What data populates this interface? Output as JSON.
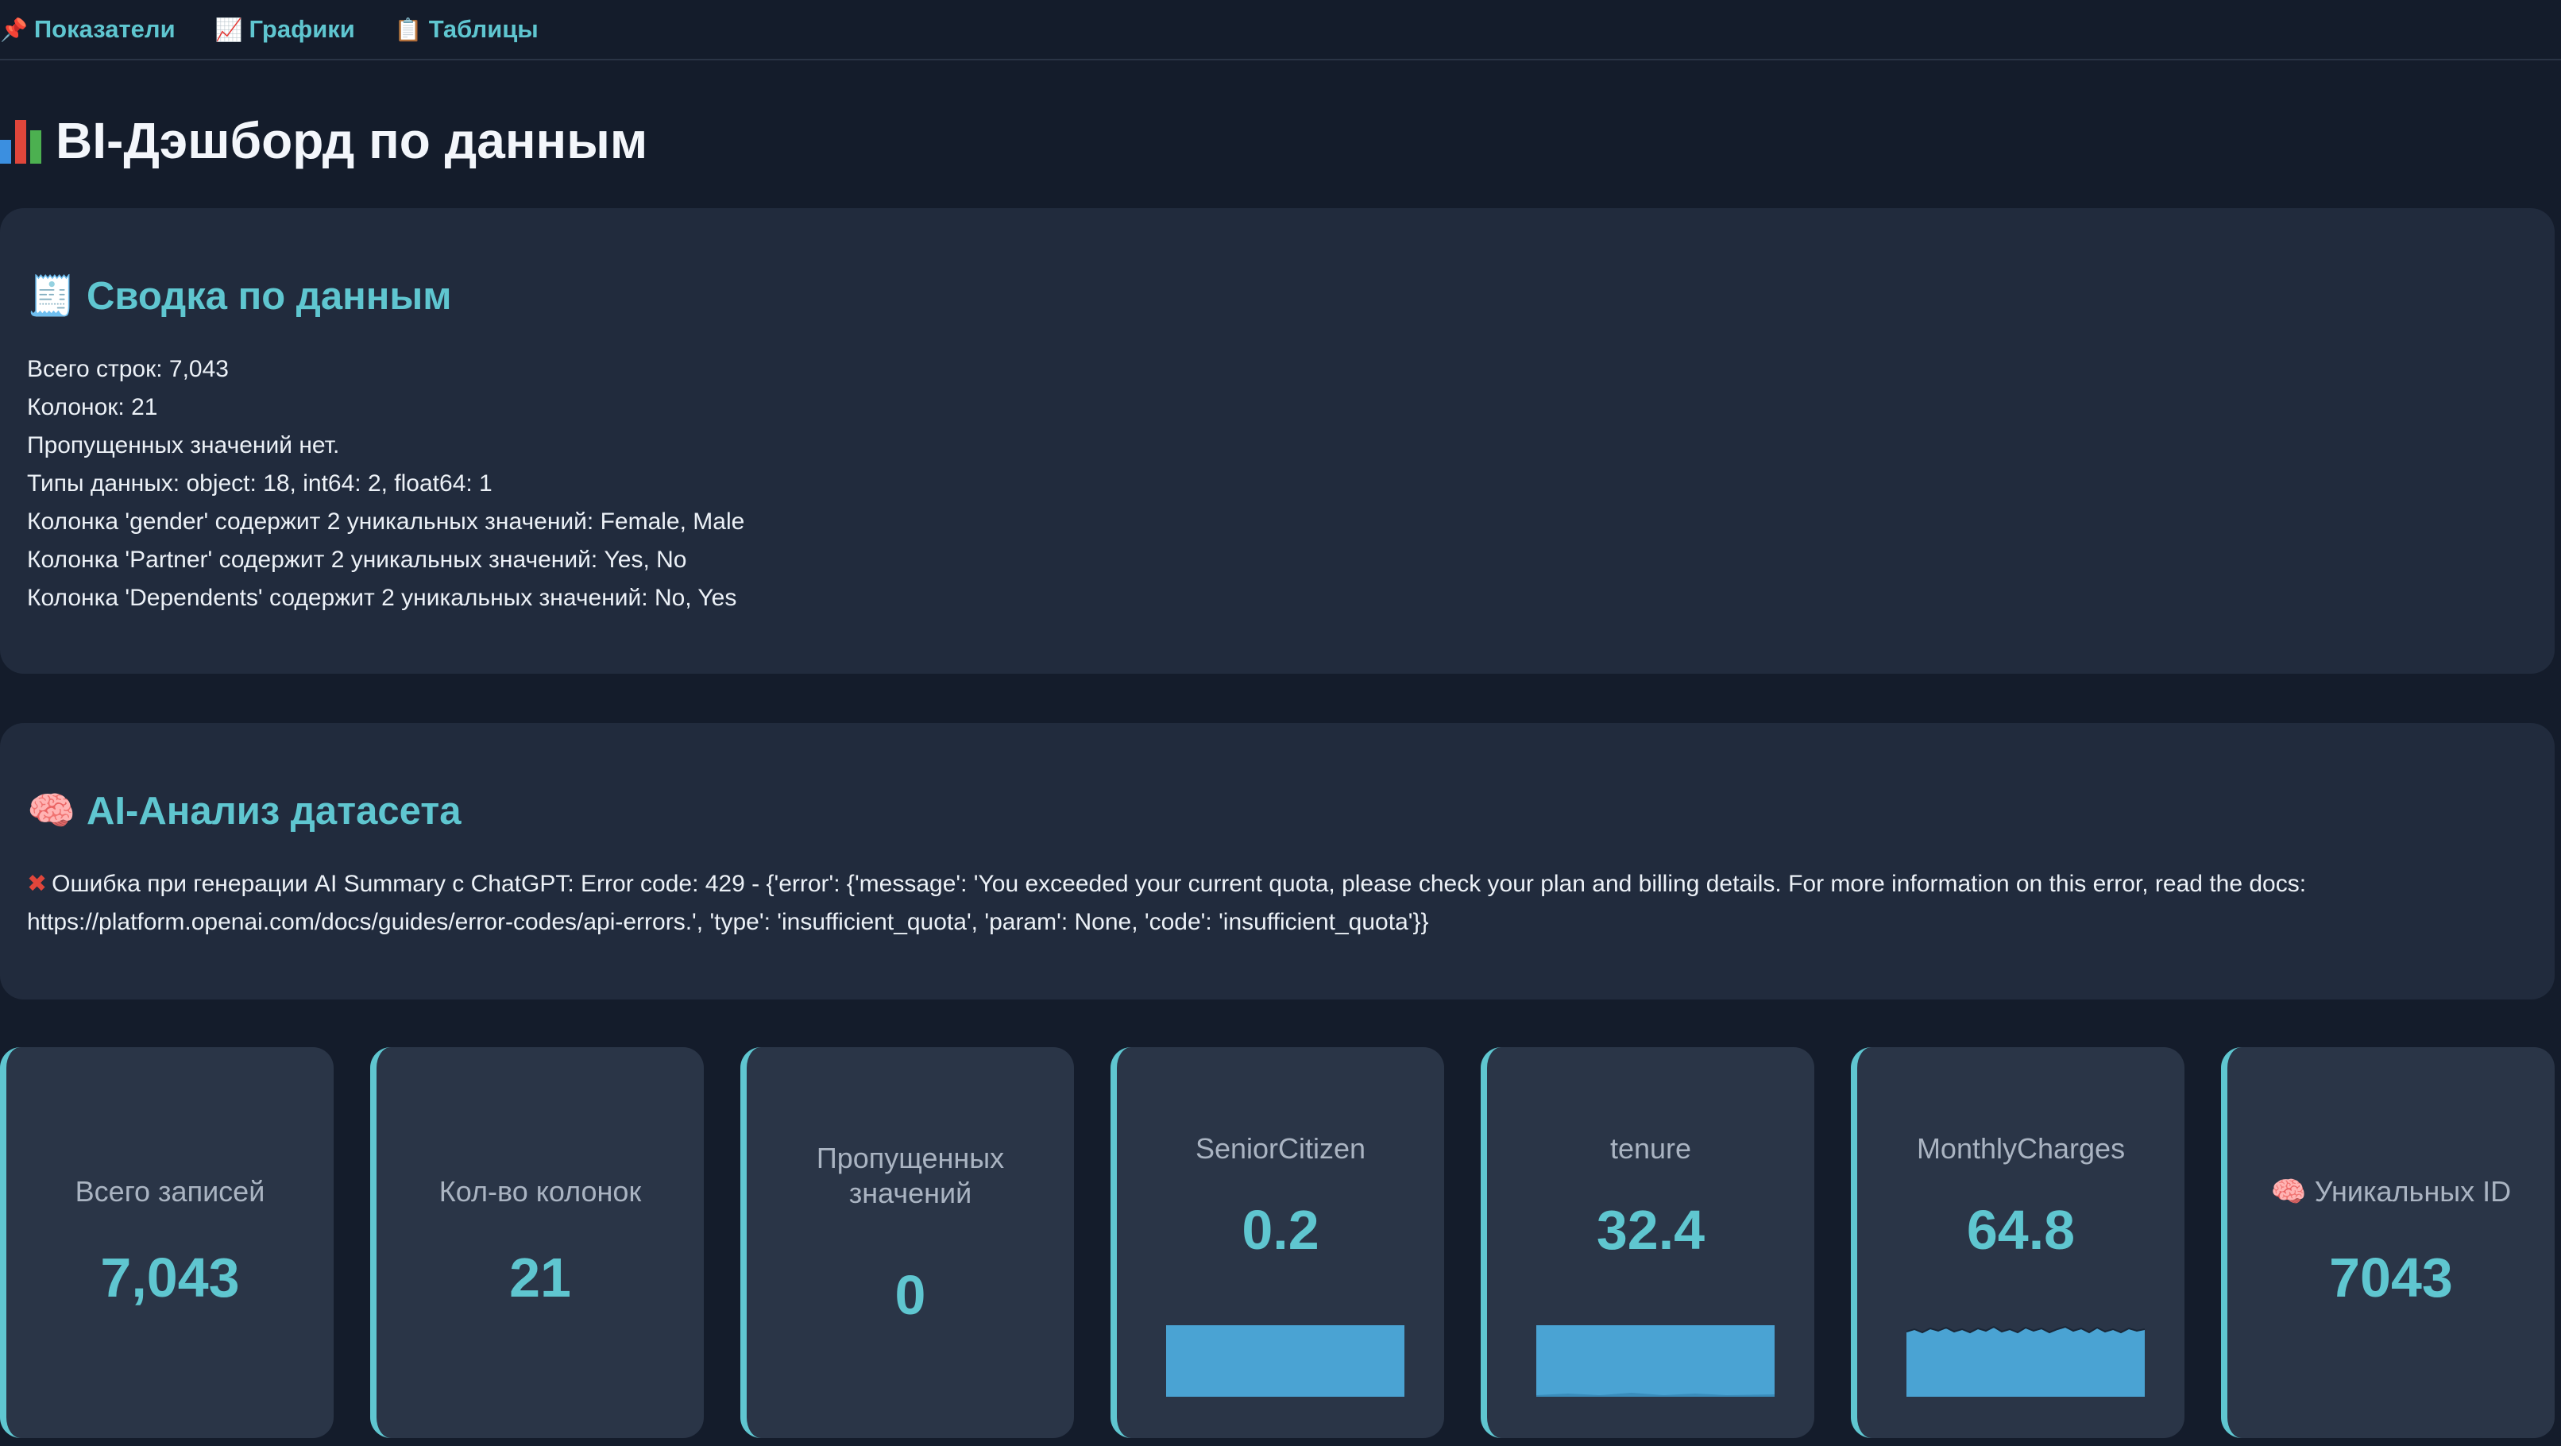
{
  "nav": {
    "items": [
      {
        "label": "Показатели",
        "icon": "pin-icon"
      },
      {
        "label": "Графики",
        "icon": "chart-up-icon"
      },
      {
        "label": "Таблицы",
        "icon": "clipboard-icon"
      }
    ]
  },
  "page": {
    "title": "BI-Дэшборд по данным"
  },
  "summary": {
    "heading": "Сводка по данным",
    "lines": [
      "Всего строк: 7,043",
      "Колонок: 21",
      "Пропущенных значений нет.",
      "Типы данных: object: 18, int64: 2, float64: 1",
      "Колонка 'gender' содержит 2 уникальных значений: Female, Male",
      "Колонка 'Partner' содержит 2 уникальных значений: Yes, No",
      "Колонка 'Dependents' содержит 2 уникальных значений: No, Yes"
    ]
  },
  "ai": {
    "heading": "AI-Анализ датасета",
    "error_text": "Ошибка при генерации AI Summary с ChatGPT: Error code: 429 - {'error': {'message': 'You exceeded your current quota, please check your plan and billing details. For more information on this error, read the docs:\nhttps://platform.openai.com/docs/guides/error-codes/api-errors.', 'type': 'insufficient_quota', 'param': None, 'code': 'insufficient_quota'}}"
  },
  "metrics": [
    {
      "label": "Всего записей",
      "value": "7,043"
    },
    {
      "label": "Кол-во колонок",
      "value": "21"
    },
    {
      "label": "Пропущенных значений",
      "value": "0"
    },
    {
      "label": "SeniorCitizen",
      "value": "0.2",
      "has_sparkline": true
    },
    {
      "label": "tenure",
      "value": "32.4",
      "has_sparkline": true
    },
    {
      "label": "MonthlyCharges",
      "value": "64.8",
      "has_sparkline": true
    },
    {
      "label": "Уникальных ID",
      "value": "7043",
      "icon": "brain-icon"
    }
  ],
  "colors": {
    "accent": "#5fc6d0",
    "background": "#141c2b",
    "card": "#212b3d",
    "metric_card": "#2a3547",
    "sparkline": "#4aa3d3",
    "error": "#e0463b"
  }
}
